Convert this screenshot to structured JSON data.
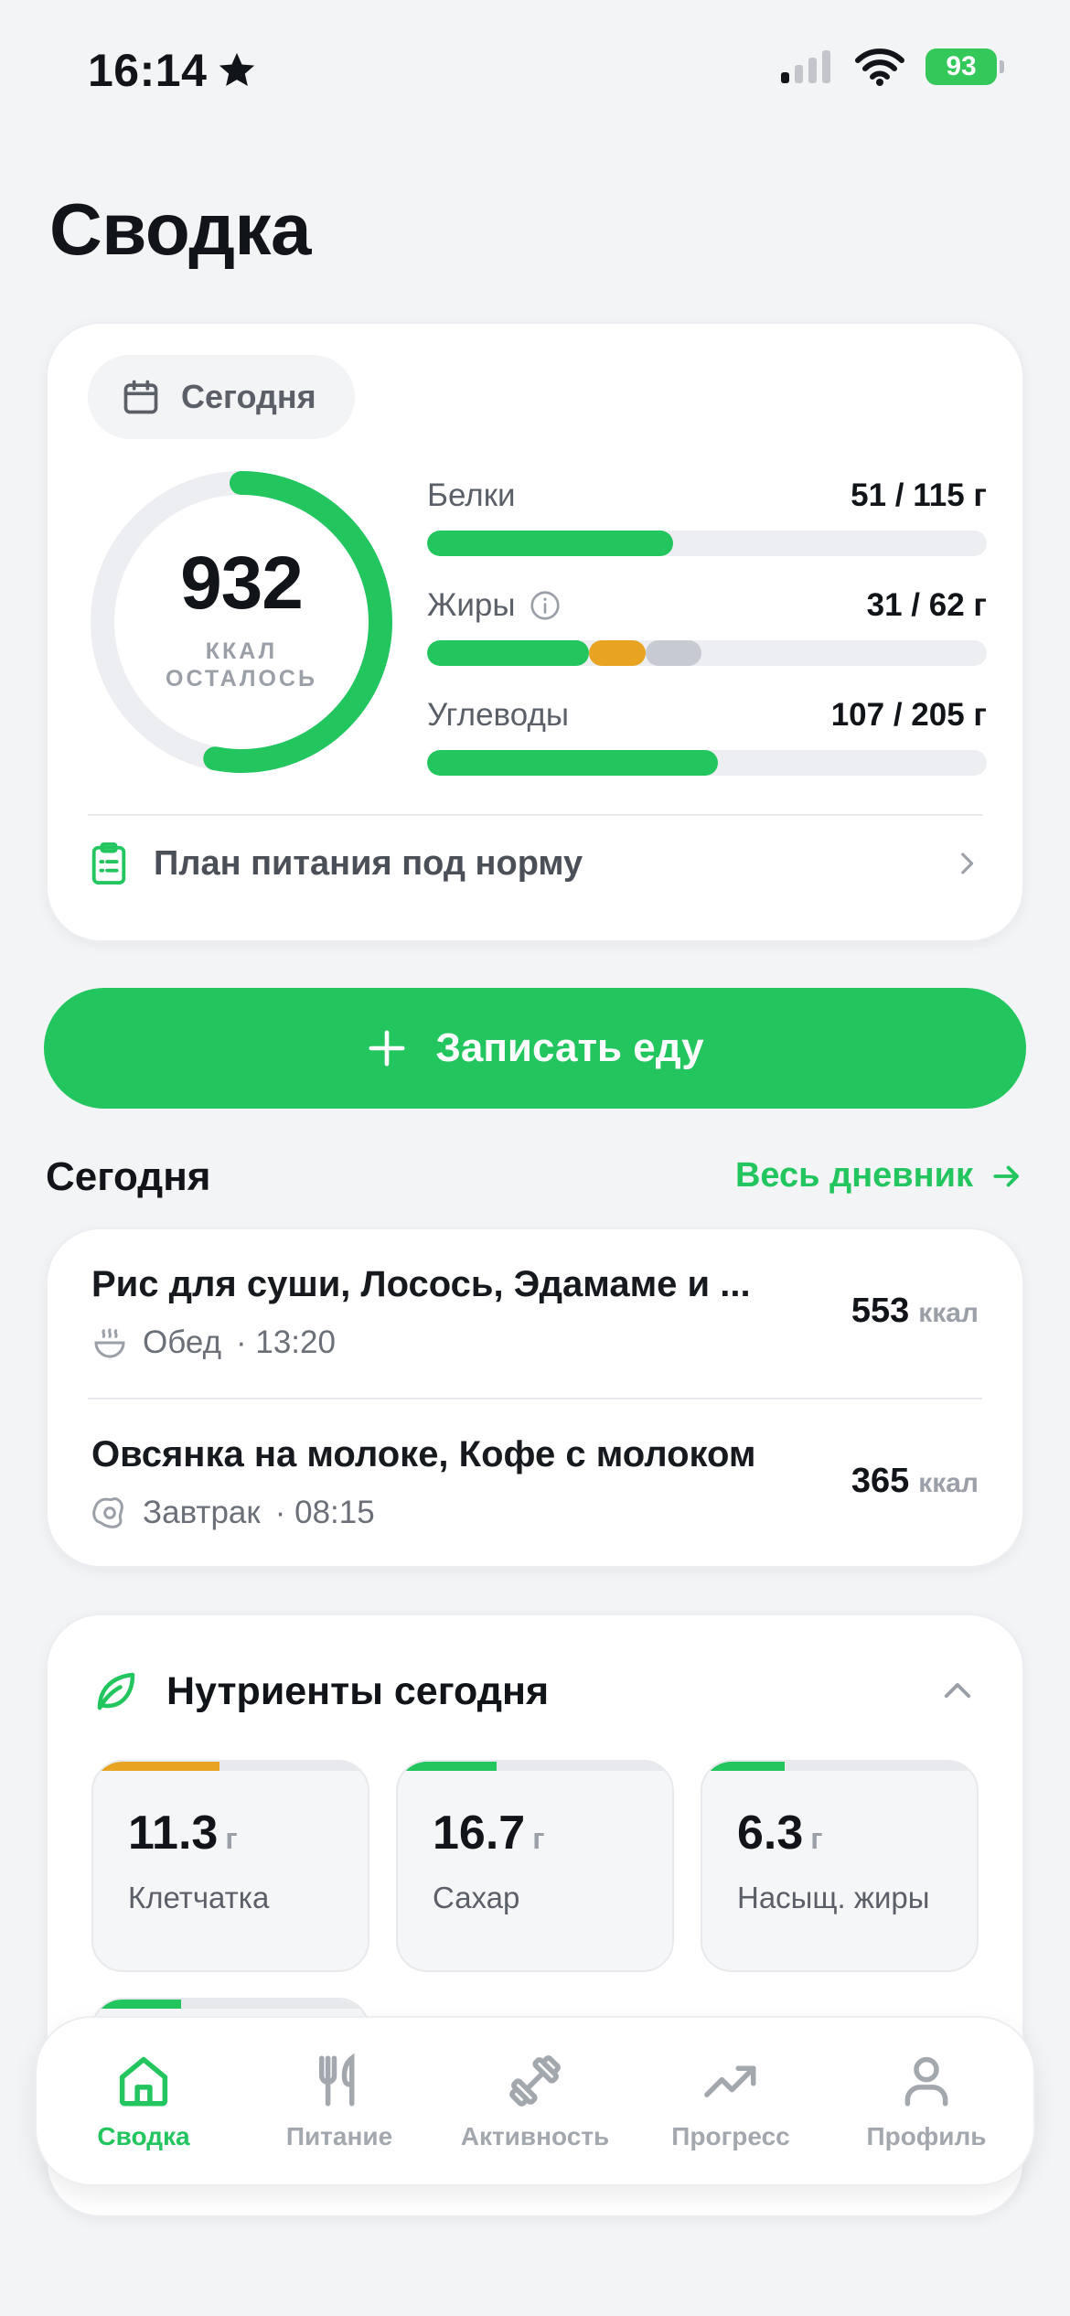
{
  "status": {
    "time": "16:14",
    "battery": "93"
  },
  "page": {
    "title": "Сводка"
  },
  "summary": {
    "date_label": "Сегодня",
    "calories_left": "932",
    "calories_unit": "ККАЛ",
    "calories_caption": "ОСТАЛОСЬ",
    "calories_progress": 0.53,
    "macros": [
      {
        "name": "Белки",
        "value": "51 / 115 г",
        "fill": 0.44
      },
      {
        "name": "Жиры",
        "value": "31 / 62 г",
        "segments": [
          0.29,
          0.1,
          0.1
        ]
      },
      {
        "name": "Углеводы",
        "value": "107 / 205 г",
        "fill": 0.52
      }
    ],
    "plan_label": "План питания под норму"
  },
  "actions": {
    "log_food": "Записать еду"
  },
  "today": {
    "title": "Сегодня",
    "diary_link": "Весь дневник",
    "meals": [
      {
        "title": "Рис для суши, Лосось, Эдамаме и ...",
        "type": "Обед",
        "time": "· 13:20",
        "kcal": "553",
        "unit": "ккал"
      },
      {
        "title": "Овсянка на молоке, Кофе с молоком",
        "type": "Завтрак",
        "time": "· 08:15",
        "kcal": "365",
        "unit": "ккал"
      }
    ]
  },
  "nutrients": {
    "title": "Нутриенты сегодня",
    "tiles": [
      {
        "value": "11.3",
        "unit": "г",
        "label": "Клетчатка",
        "fill": 0.46,
        "color": "#e8a323"
      },
      {
        "value": "16.7",
        "unit": "г",
        "label": "Сахар",
        "fill": 0.36,
        "color": "#22c55e"
      },
      {
        "value": "6.3",
        "unit": "г",
        "label": "Насыщ. жиры",
        "fill": 0.3,
        "color": "#22c55e"
      }
    ],
    "peek_fill": 0.32
  },
  "tabs": [
    {
      "label": "Сводка",
      "icon": "home-icon"
    },
    {
      "label": "Питание",
      "icon": "fork-knife-icon"
    },
    {
      "label": "Активность",
      "icon": "dumbbell-icon"
    },
    {
      "label": "Прогресс",
      "icon": "trend-icon"
    },
    {
      "label": "Профиль",
      "icon": "person-icon"
    }
  ],
  "colors": {
    "accent": "#22c55e",
    "warning": "#e8a323",
    "neutral": "#c7cad0"
  }
}
